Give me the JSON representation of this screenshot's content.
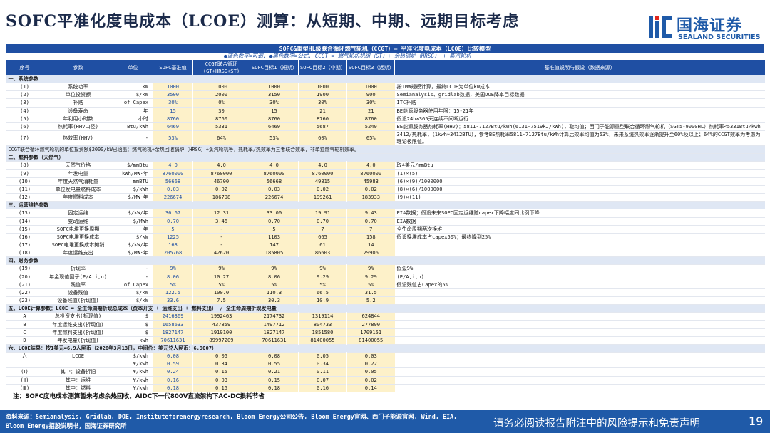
{
  "header": {
    "title": "SOFC平准化度电成本（LCOE）测算：从短期、中期、远期目标考虑",
    "logo_cn": "国海证券",
    "logo_en": "SEALAND SECURITIES"
  },
  "table": {
    "caption": "SOFC&重型HL级联合循环燃气轮机（CCGT）— 平准化度电成本（LCOE）比较模型",
    "legend": "●蓝色数字=可调, ●黑色数字=公式, CCGT = 燃气轮机机组（GT）+ 余热锅炉（HRSG） + 蒸汽轮机",
    "headers": [
      "序号",
      "参数",
      "单位",
      "SOFC基准值",
      "CCGT联合循环(GT+HRSG+ST)",
      "SOFC目标1（短期）",
      "SOFC目标2（中期）",
      "SOFC目标3（远期）",
      "基准值说明与假设（数据来源）"
    ],
    "sections": [
      {
        "title": "一、系统参数",
        "rows": [
          {
            "no": "(1)",
            "item": "系统功率",
            "unit": "kW",
            "values": [
              "1000",
              "1000",
              "1000",
              "1000",
              "1000"
            ],
            "note": "按1MW规模计算，最终LCOE为单位kW成本"
          },
          {
            "no": "(2)",
            "item": "单位投资额",
            "unit": "$/kW",
            "values": [
              "3500",
              "2000",
              "3150",
              "1900",
              "900"
            ],
            "note": "Semianalysis、gridlab数据，美国DOE降本目标数据"
          },
          {
            "no": "(3)",
            "item": "补贴",
            "unit": "of Capex",
            "values": [
              "30%",
              "0%",
              "30%",
              "30%",
              "30%"
            ],
            "note": "ITC补贴"
          },
          {
            "no": "(4)",
            "item": "设备寿命",
            "unit": "年",
            "values": [
              "15",
              "30",
              "15",
              "21",
              "21"
            ],
            "note": "BE能源服务器使用年限：15-21年"
          },
          {
            "no": "(5)",
            "item": "年利用小时数",
            "unit": "小时",
            "values": [
              "8760",
              "8760",
              "8760",
              "8760",
              "8760"
            ],
            "note": "假设24h×365天连续不间断运行"
          },
          {
            "no": "(6)",
            "item": "热耗率(HHV口径)",
            "unit": "Btu/kWh",
            "values": [
              "6469",
              "5331",
              "6469",
              "5687",
              "5249"
            ],
            "note": "BE能源服务器热耗率(HHV)：5811-7127Btu/kWh(6131-7519kJ/kWh)，取均值；西门子能源重型联合循环燃气轮机（SGT5-9000HL）热耗率<5331Btu/kwh"
          },
          {
            "no": "(7)",
            "item": "热效率(HHV)",
            "unit": "-",
            "values": [
              "53%",
              "64%",
              "53%",
              "60%",
              "65%"
            ],
            "note": "3412/热耗率，（1kwh≈3412BTU），参考BE热耗率5811-7127Btu/kWh计算后效率均值为53%，未来系统热效率逐渐提升至60%及以上；64%的CCGT效率为考虑为理论极限值。",
            "tall": true
          }
        ],
        "footnote": "CCGT联合循环燃气轮机的单位投资额$2000/kW已涵盖：燃气轮机+余热回收锅炉（HRSG）+蒸汽轮机等，热耗率/热效率为三者联合效率，非单独燃气轮机效率。"
      },
      {
        "title": "二、燃料参数（天然气）",
        "rows": [
          {
            "no": "(8)",
            "item": "天然气价格",
            "unit": "$/mmBtu",
            "values": [
              "4.0",
              "4.0",
              "4.0",
              "4.0",
              "4.0"
            ],
            "note": "取4美元/mmBtu"
          },
          {
            "no": "(9)",
            "item": "年发电量",
            "unit": "kWh/MW·年",
            "values": [
              "8760000",
              "8760000",
              "8760000",
              "8760000",
              "8760000"
            ],
            "note": "(1)×(5)"
          },
          {
            "no": "(10)",
            "item": "年度天然气消耗量",
            "unit": "mmBTU",
            "values": [
              "56668",
              "46700",
              "56668",
              "49815",
              "45983"
            ],
            "note": "(6)×(9)/1000000"
          },
          {
            "no": "(11)",
            "item": "单位发电量燃料成本",
            "unit": "$/kWh",
            "values": [
              "0.03",
              "0.02",
              "0.03",
              "0.02",
              "0.02"
            ],
            "note": "(8)×(6)/1000000"
          },
          {
            "no": "(12)",
            "item": "年度燃料成本",
            "unit": "$/MW·年",
            "values": [
              "226674",
              "186798",
              "226674",
              "199261",
              "183933"
            ],
            "note": "(9)×(11)"
          }
        ]
      },
      {
        "title": "三、运营维护参数",
        "rows": [
          {
            "no": "(13)",
            "item": "固定运维",
            "unit": "$/kW/年",
            "values": [
              "36.67",
              "12.31",
              "33.00",
              "19.91",
              "9.43"
            ],
            "note": "EIA数据；假设未来SOFC固定运维随capex下降幅度同比例下降"
          },
          {
            "no": "(14)",
            "item": "变动运维",
            "unit": "$/MWh",
            "values": [
              "0.70",
              "3.46",
              "0.70",
              "0.70",
              "0.70"
            ],
            "note": "EIA数据"
          },
          {
            "no": "(15)",
            "item": "SOFC电堆更换周期",
            "unit": "年",
            "values": [
              "5",
              "-",
              "5",
              "7",
              "7"
            ],
            "note": "全生命周期两次换堆"
          },
          {
            "no": "(16)",
            "item": "SOFC电堆更换成本",
            "unit": "$/kW",
            "values": [
              "1225",
              "-",
              "1103",
              "665",
              "158"
            ],
            "note": "假设换堆成本占capex50%；最终降到25%"
          },
          {
            "no": "(17)",
            "item": "SOFC电堆更换成本摊销",
            "unit": "$/kW/年",
            "values": [
              "163",
              "-",
              "147",
              "61",
              "14"
            ],
            "note": ""
          },
          {
            "no": "(18)",
            "item": "年度运维支出",
            "unit": "$/MW·年",
            "values": [
              "205768",
              "42620",
              "185805",
              "86603",
              "29906"
            ],
            "note": ""
          }
        ]
      },
      {
        "title": "四、财务参数",
        "rows": [
          {
            "no": "(19)",
            "item": "折现率",
            "unit": "-",
            "values": [
              "9%",
              "9%",
              "9%",
              "9%",
              "9%"
            ],
            "note": "假设9%"
          },
          {
            "no": "(20)",
            "item": "年金现值因子(P/A,i,n)",
            "unit": "-",
            "values": [
              "8.06",
              "10.27",
              "8.06",
              "9.29",
              "9.29"
            ],
            "note": "(P/A,i,n)"
          },
          {
            "no": "(21)",
            "item": "残值率",
            "unit": "of Capex",
            "values": [
              "5%",
              "5%",
              "5%",
              "5%",
              "5%"
            ],
            "note": "假设残值占Capex的5%"
          },
          {
            "no": "(22)",
            "item": "设备残值",
            "unit": "$/kW",
            "values": [
              "122.5",
              "100.0",
              "110.3",
              "66.5",
              "31.5"
            ],
            "note": ""
          },
          {
            "no": "(23)",
            "item": "设备残值(折现值)",
            "unit": "$/kW",
            "values": [
              "33.6",
              "7.5",
              "30.3",
              "10.9",
              "5.2"
            ],
            "note": ""
          }
        ]
      },
      {
        "title": "五、LCOE计算参数：LCOE = 全生命周期折现总成本（资本开支 + 运维支出 + 燃料支出） / 全生命周期折现发电量",
        "rows": [
          {
            "no": "A",
            "item": "总投资支出(折现值)",
            "unit": "$",
            "values": [
              "2416369",
              "1992463",
              "2174732",
              "1319114",
              "624844"
            ],
            "note": ""
          },
          {
            "no": "B",
            "item": "年度运维支出(折现值)",
            "unit": "$",
            "values": [
              "1658633",
              "437859",
              "1497712",
              "804733",
              "277890"
            ],
            "note": ""
          },
          {
            "no": "C",
            "item": "年度燃料支出(折现值)",
            "unit": "$",
            "values": [
              "1827147",
              "1919100",
              "1827147",
              "1851580",
              "1709151"
            ],
            "note": ""
          },
          {
            "no": "D",
            "item": "年发电量(折现值)",
            "unit": "kwh",
            "values": [
              "70611631",
              "89997209",
              "70611631",
              "81400055",
              "81400055"
            ],
            "note": ""
          }
        ]
      },
      {
        "title": "六、LCOE结果：按1美元=6.9人民币（2026年3月13日，中间价：美元兑人民币：6.9007）",
        "rows": [
          {
            "no": "六",
            "item": "LCOE",
            "unit": "$/kwh",
            "values": [
              "0.08",
              "0.05",
              "0.08",
              "0.05",
              "0.03"
            ],
            "note": "",
            "lcoe_usd": true
          },
          {
            "no": "",
            "item": "",
            "unit": "¥/kwh",
            "values": [
              "0.59",
              "0.34",
              "0.55",
              "0.34",
              "0.22"
            ],
            "note": "",
            "lcoe_cny": true
          },
          {
            "no": "(Ⅰ)",
            "item": "其中：设备折旧",
            "unit": "¥/kwh",
            "values": [
              "0.24",
              "0.15",
              "0.21",
              "0.11",
              "0.05"
            ],
            "note": ""
          },
          {
            "no": "(Ⅱ)",
            "item": "其中：运维",
            "unit": "¥/kwh",
            "values": [
              "0.16",
              "0.03",
              "0.15",
              "0.07",
              "0.02"
            ],
            "note": ""
          },
          {
            "no": "(Ⅲ)",
            "item": "其中：燃料",
            "unit": "¥/kwh",
            "values": [
              "0.18",
              "0.15",
              "0.18",
              "0.16",
              "0.14"
            ],
            "note": ""
          }
        ]
      }
    ],
    "bottom_note": "注：SOFC度电成本测算暂未考虑余热回收、AIDC下一代800V直流架构下AC-DC损耗节省"
  },
  "footer": {
    "source": "资料来源：Semianalysis, Gridlab, DOE, Instituteforenergyresearch, Bloom Energy公司公告, Bloom Energy官网、西门子能源官网, Wind, EIA, Bloom Energy招股说明书，国海证券研究所",
    "disclaimer": "请务必阅读报告附注中的风险提示和免责声明",
    "page": "19"
  },
  "colors": {
    "brand_blue": "#1f5aa8",
    "header_blue": "#1f4fa3",
    "cell_yellow": "#fdf1c9",
    "section_gray": "#dfe7f4"
  }
}
